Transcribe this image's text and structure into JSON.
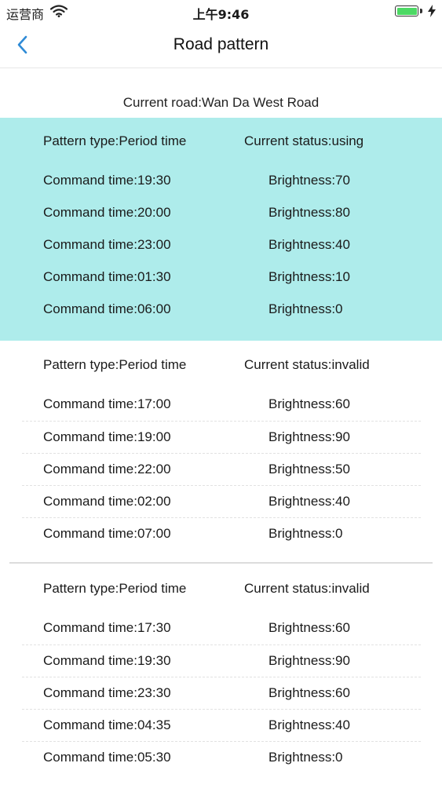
{
  "status_bar": {
    "carrier": "运营商",
    "time": "上午9:46",
    "battery_level": 1.0,
    "charging_icon": "bolt-icon"
  },
  "nav": {
    "title": "Road pattern",
    "back_icon": "chevron-left-icon"
  },
  "current_road": "Current road:Wan Da West Road",
  "patterns": [
    {
      "type": "Pattern type:Period time",
      "status": "Current status:using",
      "highlight": true,
      "commands": [
        {
          "time": "Command time:19:30",
          "brightness": "Brightness:70"
        },
        {
          "time": "Command time:20:00",
          "brightness": "Brightness:80"
        },
        {
          "time": "Command time:23:00",
          "brightness": "Brightness:40"
        },
        {
          "time": "Command time:01:30",
          "brightness": "Brightness:10"
        },
        {
          "time": "Command time:06:00",
          "brightness": "Brightness:0"
        }
      ]
    },
    {
      "type": "Pattern type:Period time",
      "status": "Current status:invalid",
      "highlight": false,
      "commands": [
        {
          "time": "Command time:17:00",
          "brightness": "Brightness:60"
        },
        {
          "time": "Command time:19:00",
          "brightness": "Brightness:90"
        },
        {
          "time": "Command time:22:00",
          "brightness": "Brightness:50"
        },
        {
          "time": "Command time:02:00",
          "brightness": "Brightness:40"
        },
        {
          "time": "Command time:07:00",
          "brightness": "Brightness:0"
        }
      ]
    },
    {
      "type": "Pattern type:Period time",
      "status": "Current status:invalid",
      "highlight": false,
      "commands": [
        {
          "time": "Command time:17:30",
          "brightness": "Brightness:60"
        },
        {
          "time": "Command time:19:30",
          "brightness": "Brightness:90"
        },
        {
          "time": "Command time:23:30",
          "brightness": "Brightness:60"
        },
        {
          "time": "Command time:04:35",
          "brightness": "Brightness:40"
        },
        {
          "time": "Command time:05:30",
          "brightness": "Brightness:0"
        }
      ]
    }
  ],
  "colors": {
    "active_bg": "#aeeceb",
    "accent": "#2f8bd6",
    "battery": "#4cd964"
  }
}
